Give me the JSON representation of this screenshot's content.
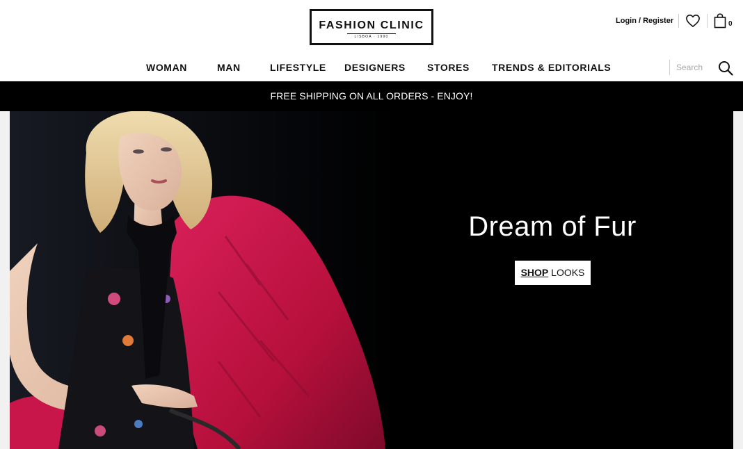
{
  "brand": {
    "name": "FASHION CLINIC",
    "tagline": "LISBOA · 1990"
  },
  "account": {
    "login_label": "Login / Register",
    "wishlist_icon": "heart-icon",
    "bag_icon": "shopping-bag-icon",
    "bag_count": "0"
  },
  "nav": {
    "items": [
      {
        "label": "WOMAN"
      },
      {
        "label": "MAN"
      },
      {
        "label": "LIFESTYLE"
      },
      {
        "label": "DESIGNERS"
      },
      {
        "label": "STORES"
      },
      {
        "label": "TRENDS & EDITORIALS"
      }
    ],
    "search": {
      "placeholder": "Search",
      "value": "",
      "icon": "search-icon"
    }
  },
  "promo": {
    "text": "FREE SHIPPING ON ALL ORDERS - ENJOY!"
  },
  "hero": {
    "title": "Dream of Fur",
    "cta_strong": "SHOP",
    "cta_rest": " LOOKS"
  },
  "colors": {
    "text": "#111111",
    "promo_bg": "#000000",
    "hero_bg": "#000000",
    "accent_fur": "#c4143f",
    "hair": "#e6cf9c"
  }
}
